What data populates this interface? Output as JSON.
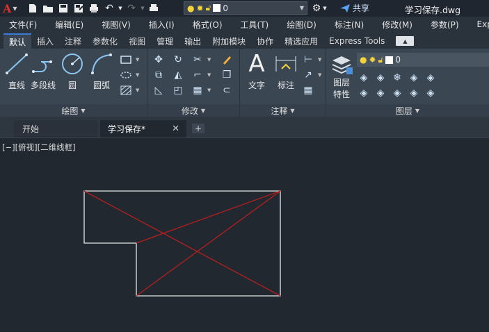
{
  "quick_access": {
    "layer_value": "0",
    "share_label": "共享",
    "doc_title": "学习保存.dwg"
  },
  "menu": [
    "文件(F)",
    "编辑(E)",
    "视图(V)",
    "插入(I)",
    "格式(O)",
    "工具(T)",
    "绘图(D)",
    "标注(N)",
    "修改(M)",
    "参数(P)",
    "Express"
  ],
  "ribbon_tabs": [
    "默认",
    "插入",
    "注释",
    "参数化",
    "视图",
    "管理",
    "输出",
    "附加模块",
    "协作",
    "精选应用",
    "Express Tools"
  ],
  "ribbon": {
    "draw_panel": "绘图",
    "modify_panel": "修改",
    "annotate_panel": "注释",
    "layers_panel": "图层",
    "line": "直线",
    "polyline": "多段线",
    "circle": "圆",
    "arc": "圆弧",
    "text": "文字",
    "dimension": "标注",
    "layer_props_1": "图层",
    "layer_props_2": "特性",
    "layer_current": "0"
  },
  "doc_tabs": {
    "start": "开始",
    "active": "学习保存*"
  },
  "viewport_label": "[−][俯视][二维线框]",
  "colors": {
    "background": "#212830",
    "outline": "#e8e8e8",
    "diagonals": "#b51f1f",
    "accent": "#3a7bd5"
  }
}
